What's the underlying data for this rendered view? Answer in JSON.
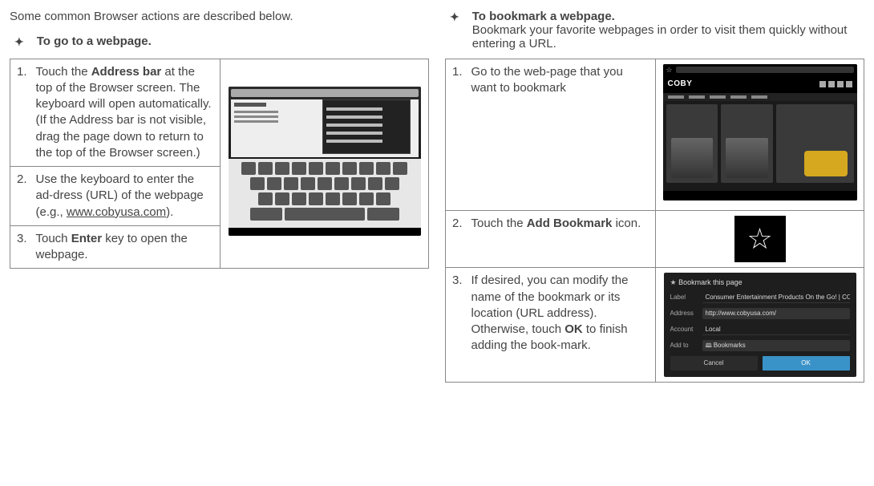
{
  "intro": "Some common Browser actions are described below.",
  "left": {
    "heading": "To go to a webpage.",
    "steps": {
      "1": {
        "num": "1.",
        "prefix": "Touch the ",
        "bold": "Address bar",
        "suffix": " at the top of the Browser screen. The keyboard will open automatically. (If the Address bar is not visible, drag the page down to return to the top of the Browser screen.)"
      },
      "2": {
        "num": "2.",
        "prefix": "Use the keyboard to enter the ad-dress (URL) of the webpage (e.g., ",
        "link": "www.cobyusa.com",
        "suffix": ")."
      },
      "3": {
        "num": "3.",
        "prefix": "Touch ",
        "bold": "Enter",
        "suffix": " key to open the webpage."
      }
    }
  },
  "right": {
    "heading": "To bookmark a webpage",
    "headingSuffix": ".",
    "sub": "Bookmark your favorite webpages in order to visit them quickly without entering a URL.",
    "steps": {
      "1": {
        "num": "1.",
        "text": "Go to the web-page that you want to bookmark"
      },
      "2": {
        "num": "2.",
        "prefix": "Touch the ",
        "bold": "Add Bookmark",
        "suffix": " icon."
      },
      "3": {
        "num": "3.",
        "prefix": "If desired, you can modify the name of the bookmark or its location (URL address). Otherwise, touch ",
        "bold": "OK",
        "suffix": " to finish adding the book-mark."
      }
    },
    "coby_logo": "COBY",
    "dialog": {
      "title": "Bookmark this page",
      "label_l": "Label",
      "label_v": "Consumer Entertainment Products On the Go! | COBY",
      "addr_l": "Address",
      "addr_v": "http://www.cobyusa.com/",
      "acct_l": "Account",
      "acct_v": "Local",
      "addto_l": "Add to",
      "addto_v": "Bookmarks",
      "cancel": "Cancel",
      "ok": "OK"
    }
  }
}
